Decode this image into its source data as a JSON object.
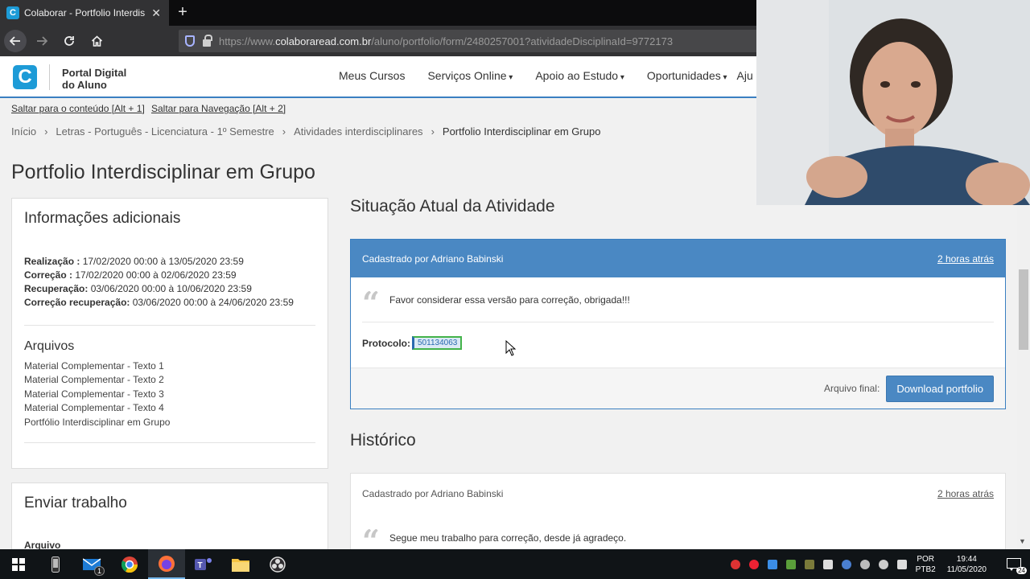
{
  "browser": {
    "tab_title": "Colaborar - Portfolio Interdiscip",
    "tab_icon_letter": "C",
    "url_prefix": "https://www.",
    "url_domain": "colaboraread.com.br",
    "url_path": "/aluno/portfolio/form/2480257001?atividadeDisciplinaId=9772173"
  },
  "header": {
    "logo_letter": "C",
    "brand_line1": "Portal Digital",
    "brand_line2": "do Aluno",
    "menu": [
      "Meus Cursos",
      "Serviços Online",
      "Apoio ao Estudo",
      "Oportunidades",
      "Aju"
    ]
  },
  "skip_links": [
    "Saltar para o conteúdo [Alt + 1]",
    "Saltar para Navegação [Alt + 2]"
  ],
  "breadcrumb": [
    "Início",
    "Letras - Português - Licenciatura - 1º Semestre",
    "Atividades interdisciplinares",
    "Portfolio Interdisciplinar em Grupo"
  ],
  "page_title": "Portfolio Interdisciplinar em Grupo",
  "info": {
    "title": "Informações adicionais",
    "rows": [
      {
        "label": "Realização :",
        "value": " 17/02/2020 00:00 à 13/05/2020 23:59"
      },
      {
        "label": "Correção :",
        "value": " 17/02/2020 00:00 à 02/06/2020 23:59"
      },
      {
        "label": "Recuperação:",
        "value": " 03/06/2020 00:00 à 10/06/2020 23:59"
      },
      {
        "label": "Correção recuperação:",
        "value": " 03/06/2020 00:00 à 24/06/2020 23:59"
      }
    ],
    "files_title": "Arquivos",
    "files": [
      "Material Complementar - Texto 1",
      "Material Complementar - Texto 2",
      "Material Complementar - Texto 3",
      "Material Complementar - Texto 4",
      "Portfólio Interdisciplinar em Grupo"
    ]
  },
  "send": {
    "title": "Enviar trabalho",
    "field_label": "Arquivo"
  },
  "status": {
    "title": "Situação Atual da Atividade",
    "author": "Cadastrado por Adriano Babinski",
    "time": "2 horas atrás",
    "comment": "Favor considerar essa versão para correção, obrigada!!!",
    "protocol_label": "Protocolo:",
    "protocol_value": "501134063",
    "final_file_label": "Arquivo final:",
    "download_label": "Download portfolio"
  },
  "history": {
    "title": "Histórico",
    "author": "Cadastrado por Adriano Babinski",
    "time": "2 horas atrás",
    "comment": "Segue meu trabalho para correção, desde já agradeço."
  },
  "taskbar": {
    "mail_badge": "1",
    "lang_line1": "POR",
    "lang_line2": "PTB2",
    "time": "19:44",
    "date": "11/05/2020",
    "notif_count": "24"
  },
  "colors": {
    "accent": "#4a88c3",
    "logo": "#1d9bd7",
    "taskbar": "#101417"
  }
}
